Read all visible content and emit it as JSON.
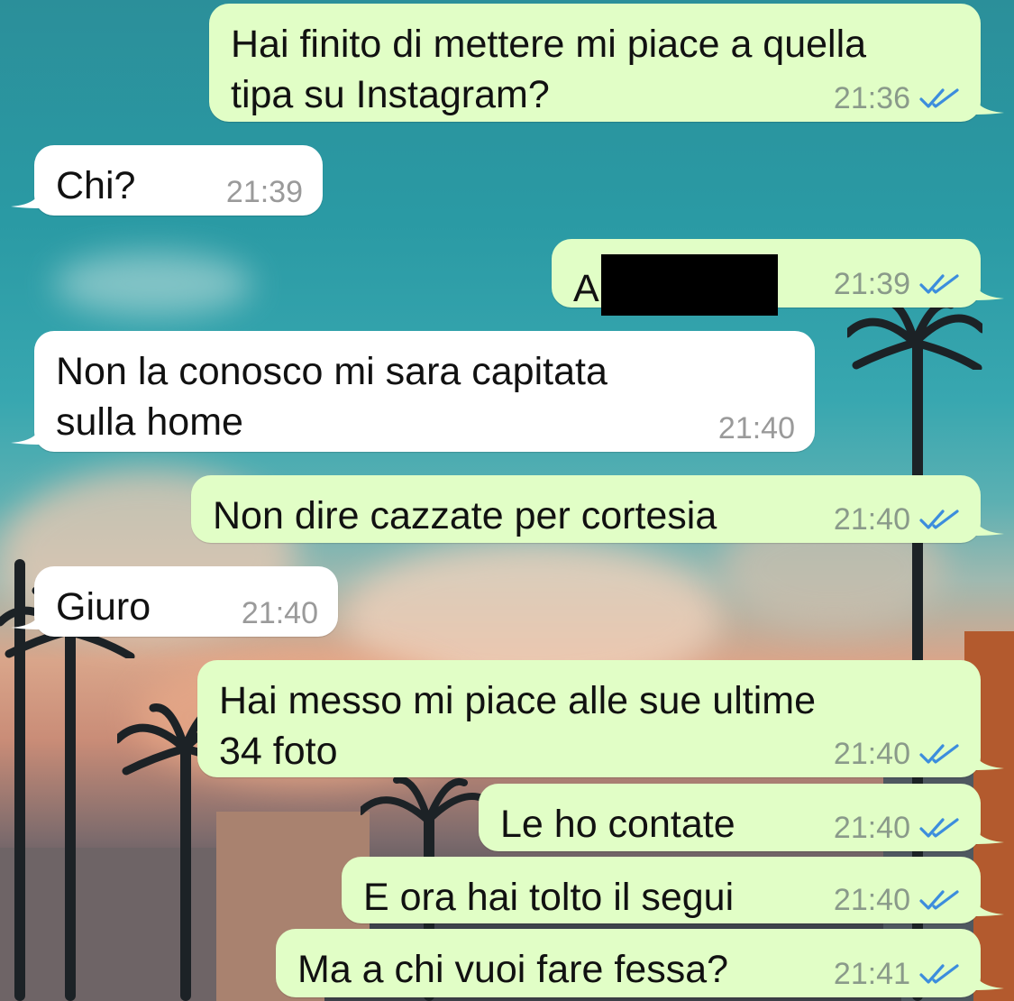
{
  "colors": {
    "outgoing_bubble": "#e1fec6",
    "incoming_bubble": "#ffffff",
    "read_ticks": "#3c8ddd",
    "timestamp": "#8a9a8a"
  },
  "icons": {
    "read_receipt": "double-check-icon",
    "redaction": "redacted-block"
  },
  "messages": [
    {
      "direction": "out",
      "text": "Hai finito di mettere mi piace a quella\ntipa su Instagram?",
      "time": "21:36",
      "read": true
    },
    {
      "direction": "in",
      "text": "Chi?",
      "time": "21:39"
    },
    {
      "direction": "out",
      "text": "A",
      "redacted": true,
      "time": "21:39",
      "read": true
    },
    {
      "direction": "in",
      "text": "Non la conosco mi sara capitata\nsulla home",
      "time": "21:40"
    },
    {
      "direction": "out",
      "text": "Non dire cazzate per cortesia",
      "time": "21:40",
      "read": true
    },
    {
      "direction": "in",
      "text": "Giuro",
      "time": "21:40"
    },
    {
      "direction": "out",
      "text": "Hai messo mi piace alle sue ultime\n34 foto",
      "time": "21:40",
      "read": true
    },
    {
      "direction": "out",
      "text": "Le ho contate",
      "time": "21:40",
      "read": true
    },
    {
      "direction": "out",
      "text": "E ora hai tolto il segui",
      "time": "21:40",
      "read": true
    },
    {
      "direction": "out",
      "text": "Ma a chi vuoi fare fessa?",
      "time": "21:41",
      "read": true
    }
  ]
}
